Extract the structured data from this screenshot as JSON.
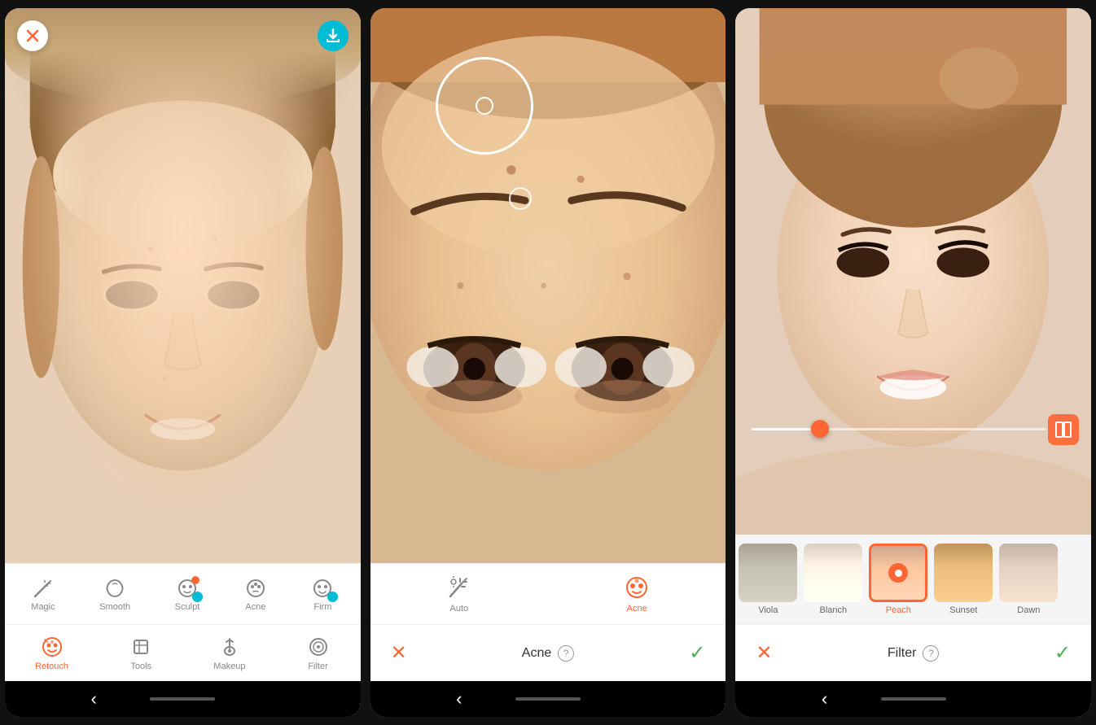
{
  "panels": [
    {
      "id": "panel1",
      "type": "retouch",
      "tools": [
        {
          "id": "magic",
          "label": "Magic",
          "icon": "✨"
        },
        {
          "id": "smooth",
          "label": "Smooth",
          "icon": "💧"
        },
        {
          "id": "sculpt",
          "label": "Sculpt",
          "icon": "😊",
          "badge": "orange",
          "badge2": "teal"
        },
        {
          "id": "acne",
          "label": "Acne",
          "icon": "😐"
        },
        {
          "id": "firm",
          "label": "Firm",
          "icon": "😄",
          "badge": "teal"
        }
      ],
      "tabs": [
        {
          "id": "retouch",
          "label": "Retouch",
          "active": true,
          "icon": "retouch"
        },
        {
          "id": "tools",
          "label": "Tools",
          "active": false,
          "icon": "tools"
        },
        {
          "id": "makeup",
          "label": "Makeup",
          "active": false,
          "icon": "makeup"
        },
        {
          "id": "filter",
          "label": "Filter",
          "active": false,
          "icon": "filter"
        }
      ]
    },
    {
      "id": "panel2",
      "type": "acne",
      "title": "Acne",
      "tools": [
        {
          "id": "auto",
          "label": "Auto",
          "icon": "auto"
        },
        {
          "id": "acne",
          "label": "Acne",
          "icon": "acne",
          "active": true
        }
      ]
    },
    {
      "id": "panel3",
      "type": "filter",
      "title": "Filter",
      "slider_value": 25,
      "filters": [
        {
          "id": "viola",
          "label": "Viola",
          "style": "viola"
        },
        {
          "id": "blanch",
          "label": "Blanch",
          "style": "blanch"
        },
        {
          "id": "peach",
          "label": "Peach",
          "style": "peach",
          "selected": true
        },
        {
          "id": "sunset",
          "label": "Sunset",
          "style": "sunset"
        },
        {
          "id": "dawn",
          "label": "Dawn",
          "style": "dawn"
        }
      ]
    }
  ],
  "nav": {
    "back_icon": "‹",
    "home_pill": ""
  },
  "icons": {
    "close": "✕",
    "cancel": "✕",
    "confirm": "✓",
    "download": "↓",
    "help": "?",
    "compare": "⊞"
  }
}
